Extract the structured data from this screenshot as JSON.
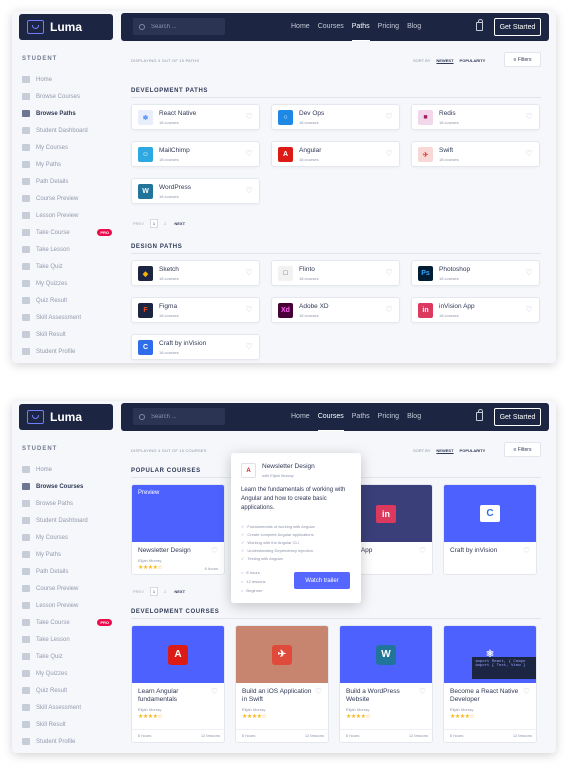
{
  "brand": {
    "name": "Luma"
  },
  "sidebar": {
    "heading": "STUDENT",
    "pro_badge": "PRO",
    "items": [
      {
        "label": "Home"
      },
      {
        "label": "Browse Courses"
      },
      {
        "label": "Browse Paths"
      },
      {
        "label": "Student Dashboard"
      },
      {
        "label": "My Courses"
      },
      {
        "label": "My Paths"
      },
      {
        "label": "Path Details"
      },
      {
        "label": "Course Preview"
      },
      {
        "label": "Lesson Preview"
      },
      {
        "label": "Take Course"
      },
      {
        "label": "Take Lesson"
      },
      {
        "label": "Take Quiz"
      },
      {
        "label": "My Quizzes"
      },
      {
        "label": "Quiz Result"
      },
      {
        "label": "Skill Assessment"
      },
      {
        "label": "Skill Result"
      },
      {
        "label": "Student Profile"
      },
      {
        "label": "Help Center"
      }
    ]
  },
  "topbar": {
    "search_placeholder": "Search ...",
    "links": [
      "Home",
      "Courses",
      "Paths",
      "Pricing",
      "Blog"
    ],
    "cta": "Get Started"
  },
  "toolbar": {
    "displaying": "DISPLAYING 4 OUT OF 10 PATHS",
    "displaying_courses": "DISPLAYING 4 OUT OF 10 COURSES",
    "sort_by": "SORT BY",
    "newest": "NEWEST",
    "popularity": "POPULARITY",
    "filters": "Filters"
  },
  "screen1": {
    "active_sidebar": 2,
    "active_link": 2,
    "dev_title": "DEVELOPMENT PATHS",
    "design_title": "DESIGN PATHS",
    "dev_paths": [
      {
        "name": "React Native",
        "count": "18 courses",
        "color": "#e8eefb",
        "fg": "#3b82f6",
        "glyph": "⚛"
      },
      {
        "name": "Dev Ops",
        "count": "18 courses",
        "color": "#1e88e5",
        "fg": "#ffffff",
        "glyph": "○"
      },
      {
        "name": "Redis",
        "count": "18 courses",
        "color": "#f2d7ea",
        "fg": "#a41e67",
        "glyph": "■"
      },
      {
        "name": "MailChimp",
        "count": "18 courses",
        "color": "#2ea8e0",
        "fg": "#ffffff",
        "glyph": "☺"
      },
      {
        "name": "Angular",
        "count": "18 courses",
        "color": "#dd1b16",
        "fg": "#ffffff",
        "glyph": "A"
      },
      {
        "name": "Swift",
        "count": "18 courses",
        "color": "#f8d7d7",
        "fg": "#e04a3b",
        "glyph": "✈"
      },
      {
        "name": "WordPress",
        "count": "18 courses",
        "color": "#21759b",
        "fg": "#ffffff",
        "glyph": "W"
      }
    ],
    "pagination": {
      "prev": "PREV",
      "pages": [
        "1",
        "2"
      ],
      "next": "NEXT"
    },
    "design_paths": [
      {
        "name": "Sketch",
        "count": "18 courses",
        "color": "#1c2541",
        "fg": "#f7b500",
        "glyph": "◆"
      },
      {
        "name": "Flinto",
        "count": "18 courses",
        "color": "#f2f2f2",
        "fg": "#555555",
        "glyph": "□"
      },
      {
        "name": "Photoshop",
        "count": "18 courses",
        "color": "#001d34",
        "fg": "#31a8ff",
        "glyph": "Ps"
      },
      {
        "name": "Figma",
        "count": "18 courses",
        "color": "#1c2541",
        "fg": "#f24e1e",
        "glyph": "F"
      },
      {
        "name": "Adobe XD",
        "count": "18 courses",
        "color": "#470137",
        "fg": "#ff61f6",
        "glyph": "Xd"
      },
      {
        "name": "inVision App",
        "count": "18 courses",
        "color": "#dc395f",
        "fg": "#ffffff",
        "glyph": "in"
      },
      {
        "name": "Craft by inVision",
        "count": "18 courses",
        "color": "#2f6ee8",
        "fg": "#ffffff",
        "glyph": "C"
      }
    ]
  },
  "screen2": {
    "active_sidebar": 1,
    "active_link": 1,
    "popular_title": "POPULAR COURSES",
    "dev_title": "DEVELOPMENT COURSES",
    "preview_label": "Preview",
    "popular": [
      {
        "title": "Newsletter Design",
        "author": "Elijah Murray",
        "stars": "★★★★☆",
        "hours": "6 hours",
        "color": "#4d61ff"
      },
      {
        "title": "",
        "author": "",
        "stars": "",
        "hours": "",
        "color": "#ffffff"
      },
      {
        "title": "ision App",
        "author": "",
        "stars": "",
        "hours": "",
        "color": "#3b3f79"
      },
      {
        "title": "Craft by inVision",
        "author": "",
        "stars": "",
        "hours": "",
        "color": "#4d61ff"
      }
    ],
    "pagination": {
      "prev": "PREV",
      "pages": [
        "1",
        "2"
      ],
      "next": "NEXT"
    },
    "dev_courses": [
      {
        "title": "Learn Angular fundamentals",
        "author": "Elijah Murray",
        "stars": "★★★★☆",
        "hours": "6 hours",
        "lessons": "12 lessons",
        "color": "#4d61ff",
        "glyph": "A",
        "glyph_bg": "#dd1b16"
      },
      {
        "title": "Build an iOS Application in Swift",
        "author": "Elijah Murray",
        "stars": "★★★★☆",
        "hours": "6 hours",
        "lessons": "12 lessons",
        "color": "#c7856f",
        "glyph": "✈",
        "glyph_bg": "#e04a3b"
      },
      {
        "title": "Build a WordPress Website",
        "author": "Elijah Murray",
        "stars": "★★★★☆",
        "hours": "6 hours",
        "lessons": "12 lessons",
        "color": "#4d61ff",
        "glyph": "W",
        "glyph_bg": "#21759b"
      },
      {
        "title": "Become a React Native Developer",
        "author": "Elijah Murray",
        "stars": "★★★★☆",
        "hours": "6 hours",
        "lessons": "12 lessons",
        "color": "#4d61ff",
        "glyph": "⚛",
        "glyph_bg": "#4d61ff"
      }
    ],
    "code_snippet": "import React, { Compo\nimport { Text, View }",
    "popup": {
      "title": "Newsletter Design",
      "author": "with Elijah Murray",
      "description": "Learn the fundamentals of working with Angular and how to create basic applications.",
      "bullets": [
        "Fundamentals of working with Angular",
        "Create complete Angular applications",
        "Working with the Angular CLI",
        "Understanding Dependency Injection",
        "Testing with Angular"
      ],
      "meta": [
        "6 hours",
        "12 lessons",
        "Beginner"
      ],
      "button": "Watch trailer"
    }
  },
  "colors": {
    "nav": "#1c2541",
    "accent": "#5567ff",
    "star": "#f9b820",
    "pro": "#ed0b4c"
  }
}
